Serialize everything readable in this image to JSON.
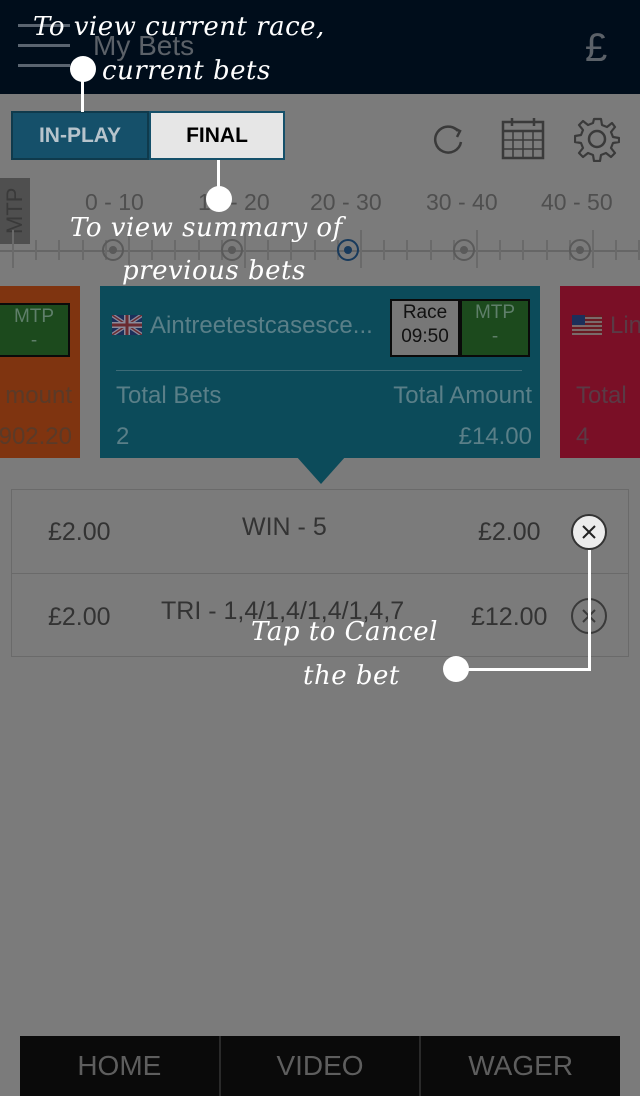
{
  "header": {
    "menu_icon": "hamburger-menu-icon",
    "title": "My Bets",
    "currency_symbol": "£"
  },
  "tabs": {
    "inplay_label": "IN-PLAY",
    "final_label": "FINAL"
  },
  "toolbar": {
    "icons": [
      "refresh-icon",
      "calendar-icon",
      "settings-gear-icon"
    ]
  },
  "mtp_axis": {
    "label": "MTP",
    "ranges": [
      "0 - 10",
      "10 - 20",
      "20 - 30",
      "30 - 40",
      "40 - 50"
    ]
  },
  "race_cards": {
    "left": {
      "mtp_label": "MTP",
      "mtp_value": "-",
      "amount_label": "mount",
      "amount_value": "902.20",
      "accent": "#7f3410"
    },
    "center": {
      "flag_icon": "uk-flag-icon",
      "race_name": "Aintreetestcasesce...",
      "race_label": "Race",
      "race_time": "09:50",
      "mtp_label": "MTP",
      "mtp_value": "-",
      "total_bets_label": "Total Bets",
      "total_bets_value": "2",
      "total_amount_label": "Total Amount",
      "total_amount_value": "£14.00",
      "accent": "#0c4b5a"
    },
    "right": {
      "flag_icon": "us-flag-icon",
      "race_name": "Lin",
      "total_label": "Total",
      "total_value": "4",
      "accent": "#7a0f26"
    }
  },
  "bets": [
    {
      "stake": "£2.00",
      "description": "WIN - 5",
      "amount": "£2.00",
      "cancel_icon": "cancel-x-icon"
    },
    {
      "stake": "£2.00",
      "description": "TRI - 1,4/1,4/1,4/1,4,7",
      "amount": "£12.00",
      "cancel_icon": "cancel-x-icon"
    }
  ],
  "bottom_nav": {
    "home_label": "HOME",
    "video_label": "VIDEO",
    "wager_label": "WAGER"
  },
  "tutorial": {
    "tip_inplay_line1": "To view current race,",
    "tip_inplay_line2": "current bets",
    "tip_final_line1": "To view summary of",
    "tip_final_line2": "previous bets",
    "tip_cancel_line1": "Tap to Cancel",
    "tip_cancel_line2": "the bet"
  }
}
